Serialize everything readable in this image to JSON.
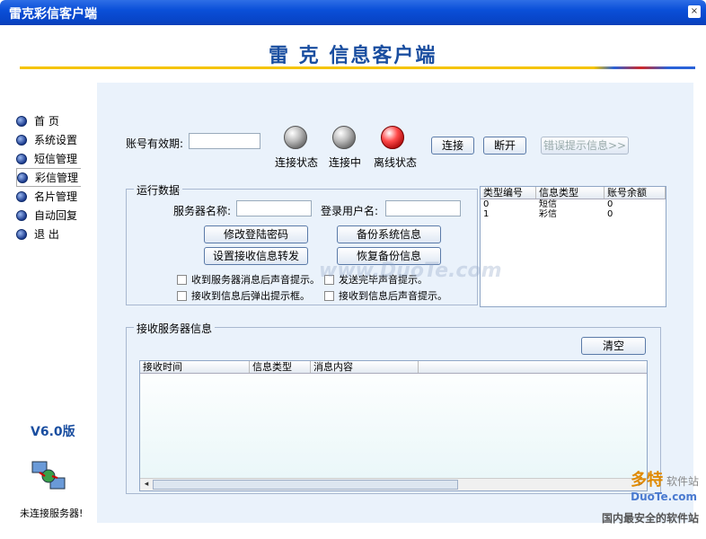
{
  "window": {
    "title": "雷克彩信客户端",
    "close_label": "×"
  },
  "header": {
    "title": "雷  克  信息客户端"
  },
  "sidebar": {
    "items": [
      {
        "label": "首    页"
      },
      {
        "label": "系统设置"
      },
      {
        "label": "短信管理"
      },
      {
        "label": "彩信管理"
      },
      {
        "label": "名片管理"
      },
      {
        "label": "自动回复"
      },
      {
        "label": "退    出"
      }
    ],
    "active_index": 3,
    "version": "V6.0版",
    "connection_status": "未连接服务器!"
  },
  "account": {
    "validity_label": "账号有效期:",
    "validity_value": ""
  },
  "indicators": [
    {
      "label": "连接状态",
      "color": "gray"
    },
    {
      "label": "连接中",
      "color": "gray"
    },
    {
      "label": "离线状态",
      "color": "red"
    }
  ],
  "buttons": {
    "connect": "连接",
    "disconnect": "断开",
    "error_hint": "错误提示信息>>",
    "change_password": "修改登陆密码",
    "backup_system": "备份系统信息",
    "forward_setting": "设置接收信息转发",
    "restore_backup": "恢复备份信息",
    "clear": "清空"
  },
  "run_data": {
    "title": "运行数据",
    "server_name_label": "服务器名称:",
    "server_name_value": "",
    "login_user_label": "登录用户名:",
    "login_user_value": "",
    "checkboxes": [
      "收到服务器消息后声音提示。",
      "发送完毕声音提示。",
      "接收到信息后弹出提示框。",
      "接收到信息后声音提示。"
    ]
  },
  "balance_table": {
    "columns": [
      "类型编号",
      "信息类型",
      "账号余额"
    ],
    "rows": [
      [
        "0",
        "短信",
        "0"
      ],
      [
        "1",
        "彩信",
        "0"
      ]
    ]
  },
  "server_msgs": {
    "title": "接收服务器信息",
    "columns": [
      "接收时间",
      "信息类型",
      "消息内容"
    ]
  },
  "watermark": {
    "brand": "多特",
    "tagline": "软件站",
    "site": "DuoTe.com",
    "slogan": "国内最安全的软件站",
    "overlay": "www.DuoTe.com"
  }
}
